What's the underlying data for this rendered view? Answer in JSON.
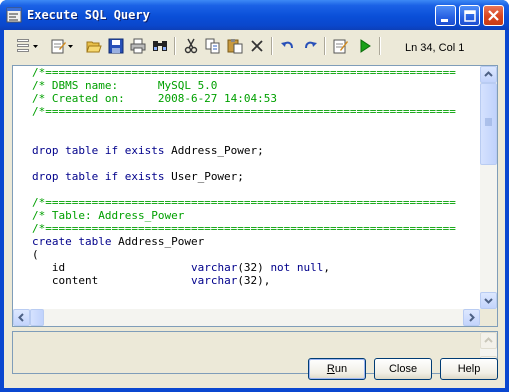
{
  "window": {
    "title": "Execute SQL Query"
  },
  "toolbar": {
    "buttons": [
      {
        "name": "sql-editor-menu",
        "icon": "sql-icon"
      },
      {
        "name": "edit-menu",
        "icon": "edit-icon"
      },
      {
        "name": "open",
        "icon": "open-folder-icon"
      },
      {
        "name": "save",
        "icon": "save-icon"
      },
      {
        "name": "print",
        "icon": "print-icon"
      },
      {
        "name": "find",
        "icon": "find-icon"
      },
      {
        "name": "cut",
        "icon": "cut-icon"
      },
      {
        "name": "copy",
        "icon": "copy-icon"
      },
      {
        "name": "paste",
        "icon": "paste-icon"
      },
      {
        "name": "delete",
        "icon": "delete-icon"
      },
      {
        "name": "undo",
        "icon": "undo-icon"
      },
      {
        "name": "redo",
        "icon": "redo-icon"
      },
      {
        "name": "edit-with",
        "icon": "edit-with-icon"
      },
      {
        "name": "run",
        "icon": "run-icon"
      }
    ],
    "cursor_position": "Ln 34, Col 1"
  },
  "editor": {
    "lines": [
      [
        {
          "cls": "c",
          "text": "/*=============================================================="
        }
      ],
      [
        {
          "cls": "c",
          "text": "/* DBMS name:      MySQL 5.0"
        }
      ],
      [
        {
          "cls": "c",
          "text": "/* Created on:     2008-6-27 14:04:53"
        }
      ],
      [
        {
          "cls": "c",
          "text": "/*=============================================================="
        }
      ],
      [],
      [],
      [
        {
          "cls": "k",
          "text": "drop table if exists "
        },
        {
          "cls": "t",
          "text": "Address_Power;"
        }
      ],
      [],
      [
        {
          "cls": "k",
          "text": "drop table if exists "
        },
        {
          "cls": "t",
          "text": "User_Power;"
        }
      ],
      [],
      [
        {
          "cls": "c",
          "text": "/*=============================================================="
        }
      ],
      [
        {
          "cls": "c",
          "text": "/* Table: Address_Power"
        }
      ],
      [
        {
          "cls": "c",
          "text": "/*=============================================================="
        }
      ],
      [
        {
          "cls": "k",
          "text": "create table "
        },
        {
          "cls": "t",
          "text": "Address_Power"
        }
      ],
      [
        {
          "cls": "t",
          "text": "("
        }
      ],
      [
        {
          "cls": "t",
          "text": "   id                   "
        },
        {
          "cls": "k",
          "text": "varchar"
        },
        {
          "cls": "t",
          "text": "(32) "
        },
        {
          "cls": "k",
          "text": "not null"
        },
        {
          "cls": "t",
          "text": ","
        }
      ],
      [
        {
          "cls": "t",
          "text": "   content              "
        },
        {
          "cls": "k",
          "text": "varchar"
        },
        {
          "cls": "t",
          "text": "(32),"
        }
      ]
    ]
  },
  "buttons": {
    "run": "Run",
    "close": "Close",
    "help": "Help"
  },
  "colors": {
    "comment": "#00a000",
    "keyword": "#00008b",
    "titlebar": "#0a4fd8"
  }
}
